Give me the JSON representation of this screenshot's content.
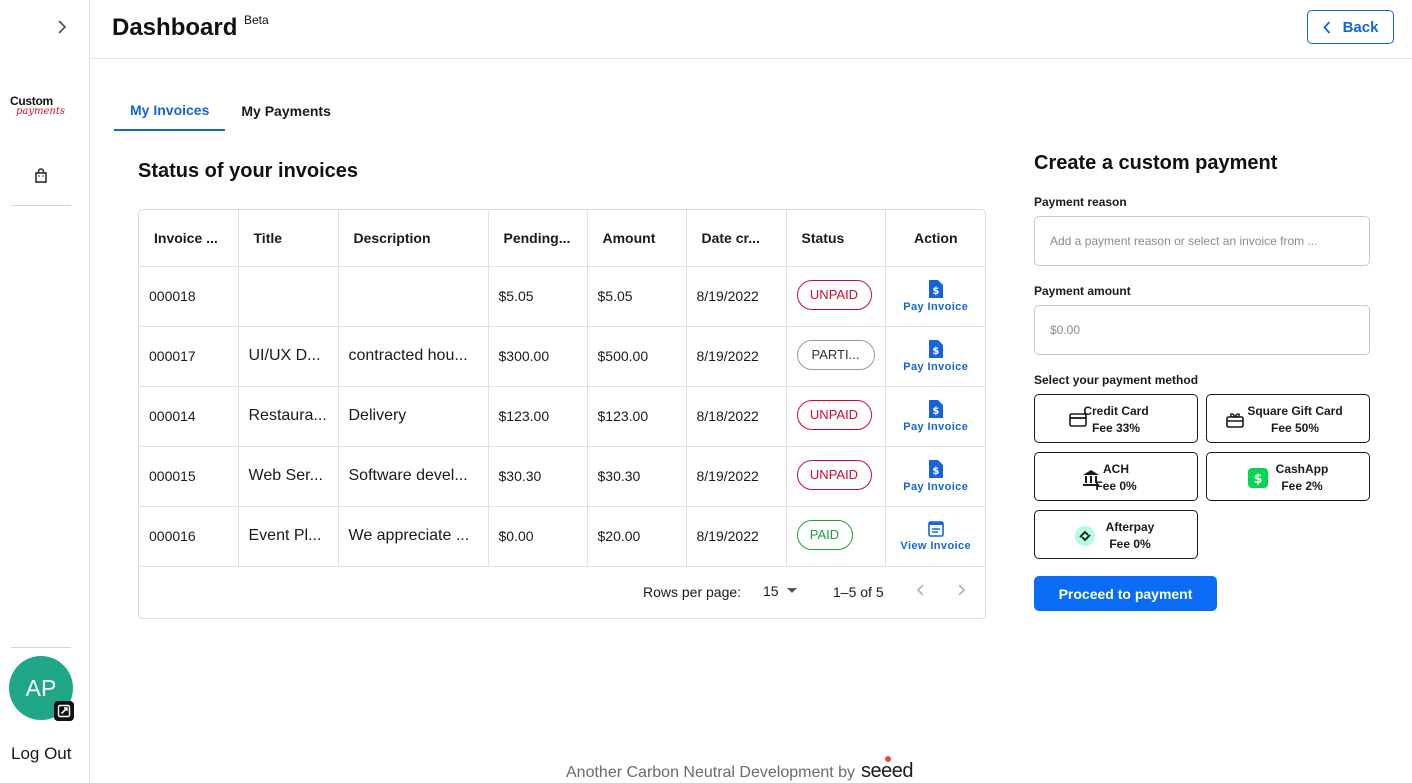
{
  "sidebar": {
    "logo_line1": "Custom",
    "logo_line2": "payments",
    "avatar_initials": "AP",
    "logout_label": "Log Out"
  },
  "header": {
    "title": "Dashboard",
    "badge": "Beta",
    "back_label": "Back"
  },
  "tabs": [
    {
      "label": "My Invoices",
      "active": true
    },
    {
      "label": "My Payments",
      "active": false
    }
  ],
  "invoices": {
    "section_title": "Status of your invoices",
    "columns": [
      "Invoice ...",
      "Title",
      "Description",
      "Pending...",
      "Amount",
      "Date cr...",
      "Status",
      "Action"
    ],
    "rows": [
      {
        "invoice": "000018",
        "title": "",
        "description": "",
        "pending": "$5.05",
        "amount": "$5.05",
        "date": "8/19/2022",
        "status": "UNPAID",
        "action": "Pay Invoice"
      },
      {
        "invoice": "000017",
        "title": "UI/UX D...",
        "description": "contracted hou...",
        "pending": "$300.00",
        "amount": "$500.00",
        "date": "8/19/2022",
        "status": "PARTI...",
        "action": "Pay Invoice"
      },
      {
        "invoice": "000014",
        "title": "Restaura...",
        "description": "Delivery",
        "pending": "$123.00",
        "amount": "$123.00",
        "date": "8/18/2022",
        "status": "UNPAID",
        "action": "Pay Invoice"
      },
      {
        "invoice": "000015",
        "title": "Web Ser...",
        "description": "Software devel...",
        "pending": "$30.30",
        "amount": "$30.30",
        "date": "8/19/2022",
        "status": "UNPAID",
        "action": "Pay Invoice"
      },
      {
        "invoice": "000016",
        "title": "Event Pl...",
        "description": "We appreciate ...",
        "pending": "$0.00",
        "amount": "$20.00",
        "date": "8/19/2022",
        "status": "PAID",
        "action": "View Invoice"
      }
    ],
    "pager": {
      "rows_per_page_label": "Rows per page:",
      "rows_per_page": "15",
      "range": "1–5 of 5"
    }
  },
  "custom_payment": {
    "title": "Create a custom payment",
    "reason_label": "Payment reason",
    "reason_placeholder": "Add a payment reason or select an invoice from ...",
    "amount_label": "Payment amount",
    "amount_placeholder": "$0.00",
    "method_label": "Select your payment method",
    "methods": [
      {
        "name": "Credit Card",
        "fee": "Fee 33%",
        "icon": "credit-card-icon"
      },
      {
        "name": "Square Gift Card",
        "fee": "Fee 50%",
        "icon": "gift-card-icon"
      },
      {
        "name": "ACH",
        "fee": "Fee 0%",
        "icon": "bank-icon"
      },
      {
        "name": "CashApp",
        "fee": "Fee 2%",
        "icon": "cashapp-icon"
      },
      {
        "name": "Afterpay",
        "fee": "Fee 0%",
        "icon": "afterpay-icon"
      }
    ],
    "proceed_label": "Proceed to payment"
  },
  "footer": {
    "text": "Another Carbon Neutral Development by",
    "brand": "seeed"
  },
  "colors": {
    "accent": "#1664d9",
    "primary_button": "#0a6cf5",
    "unpaid": "#c8102e",
    "paid": "#1f9d3c",
    "avatar": "#1fa787",
    "cashapp": "#00d64f",
    "afterpay": "#b2fce4"
  }
}
